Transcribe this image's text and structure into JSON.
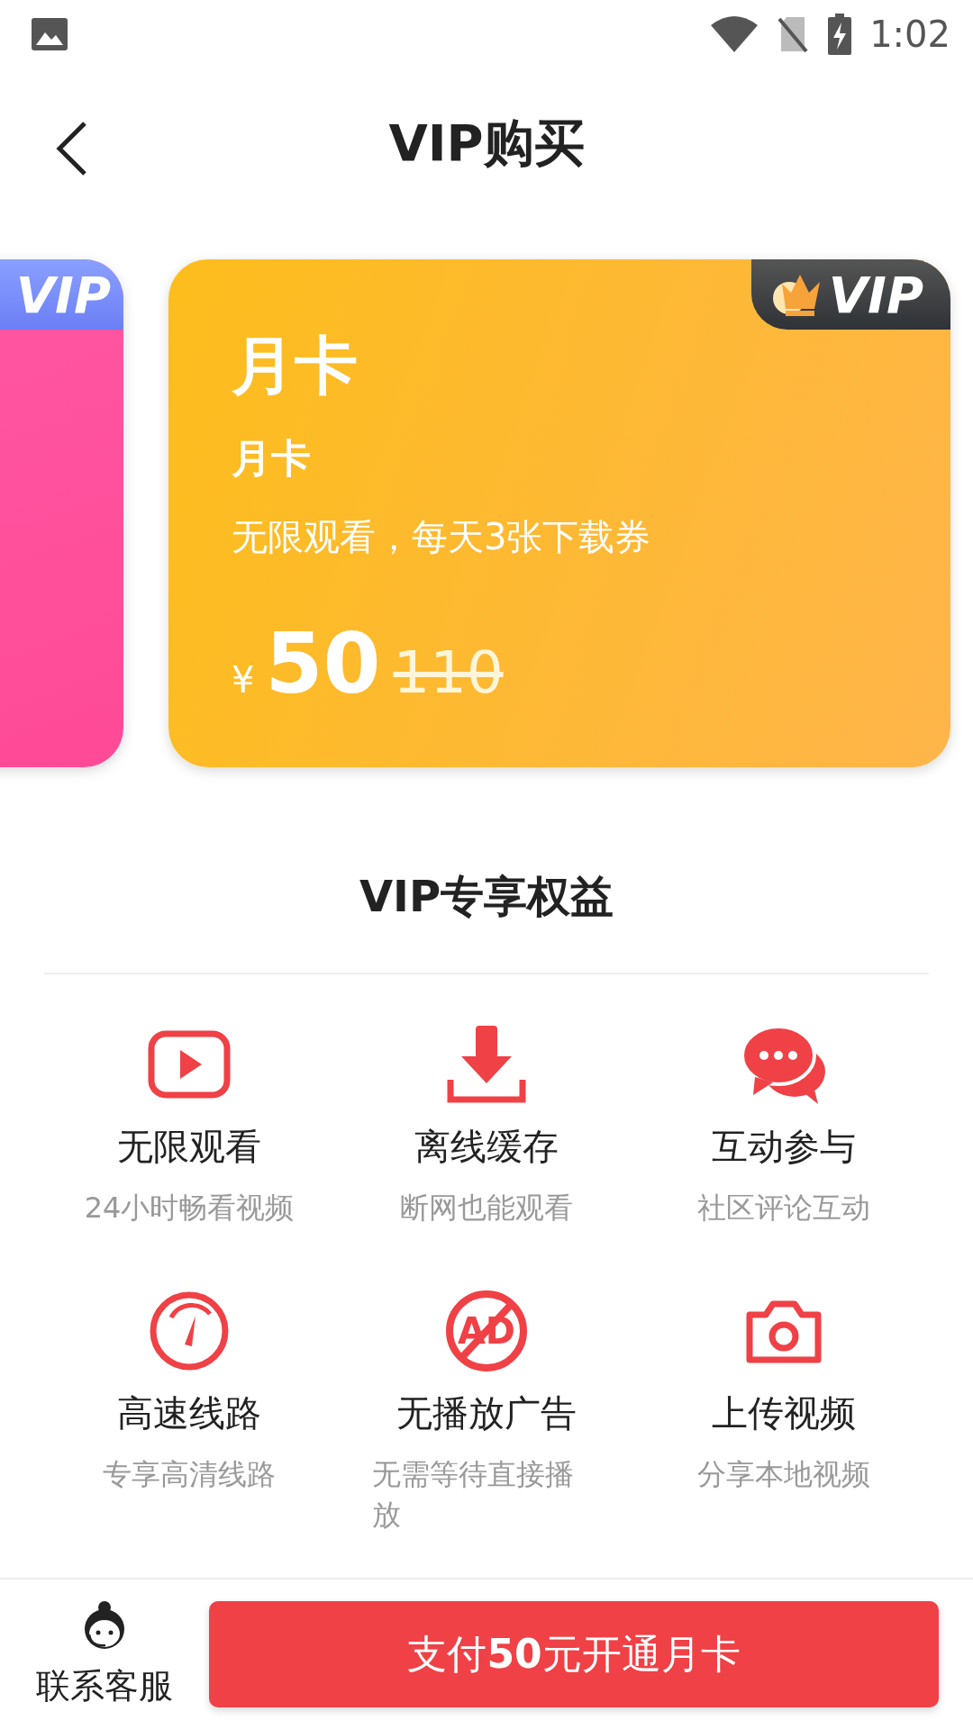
{
  "status_bar": {
    "time": "1:02"
  },
  "header": {
    "title": "VIP购买"
  },
  "cards": [
    {
      "kind": "side",
      "badge": "VIP"
    },
    {
      "kind": "main",
      "badge": "VIP",
      "name": "月卡",
      "subtitle": "月卡",
      "description": "无限观看，每天3张下载券",
      "currency": "¥",
      "price": "50",
      "original_price": "110"
    }
  ],
  "benefits": {
    "title": "VIP专享权益",
    "items": [
      {
        "kind": "play",
        "title": "无限观看",
        "subtitle": "24小时畅看视频"
      },
      {
        "kind": "download",
        "title": "离线缓存",
        "subtitle": "断网也能观看"
      },
      {
        "kind": "chat",
        "title": "互动参与",
        "subtitle": "社区评论互动"
      },
      {
        "kind": "speed",
        "title": "高速线路",
        "subtitle": "专享高清线路"
      },
      {
        "kind": "no-ad",
        "title": "无播放广告",
        "subtitle": "无需等待直接播放",
        "badge": "AD"
      },
      {
        "kind": "camera",
        "title": "上传视频",
        "subtitle": "分享本地视频"
      }
    ]
  },
  "bottom_bar": {
    "contact_label": "联系客服",
    "pay_button": "支付**50**元开通月卡"
  }
}
